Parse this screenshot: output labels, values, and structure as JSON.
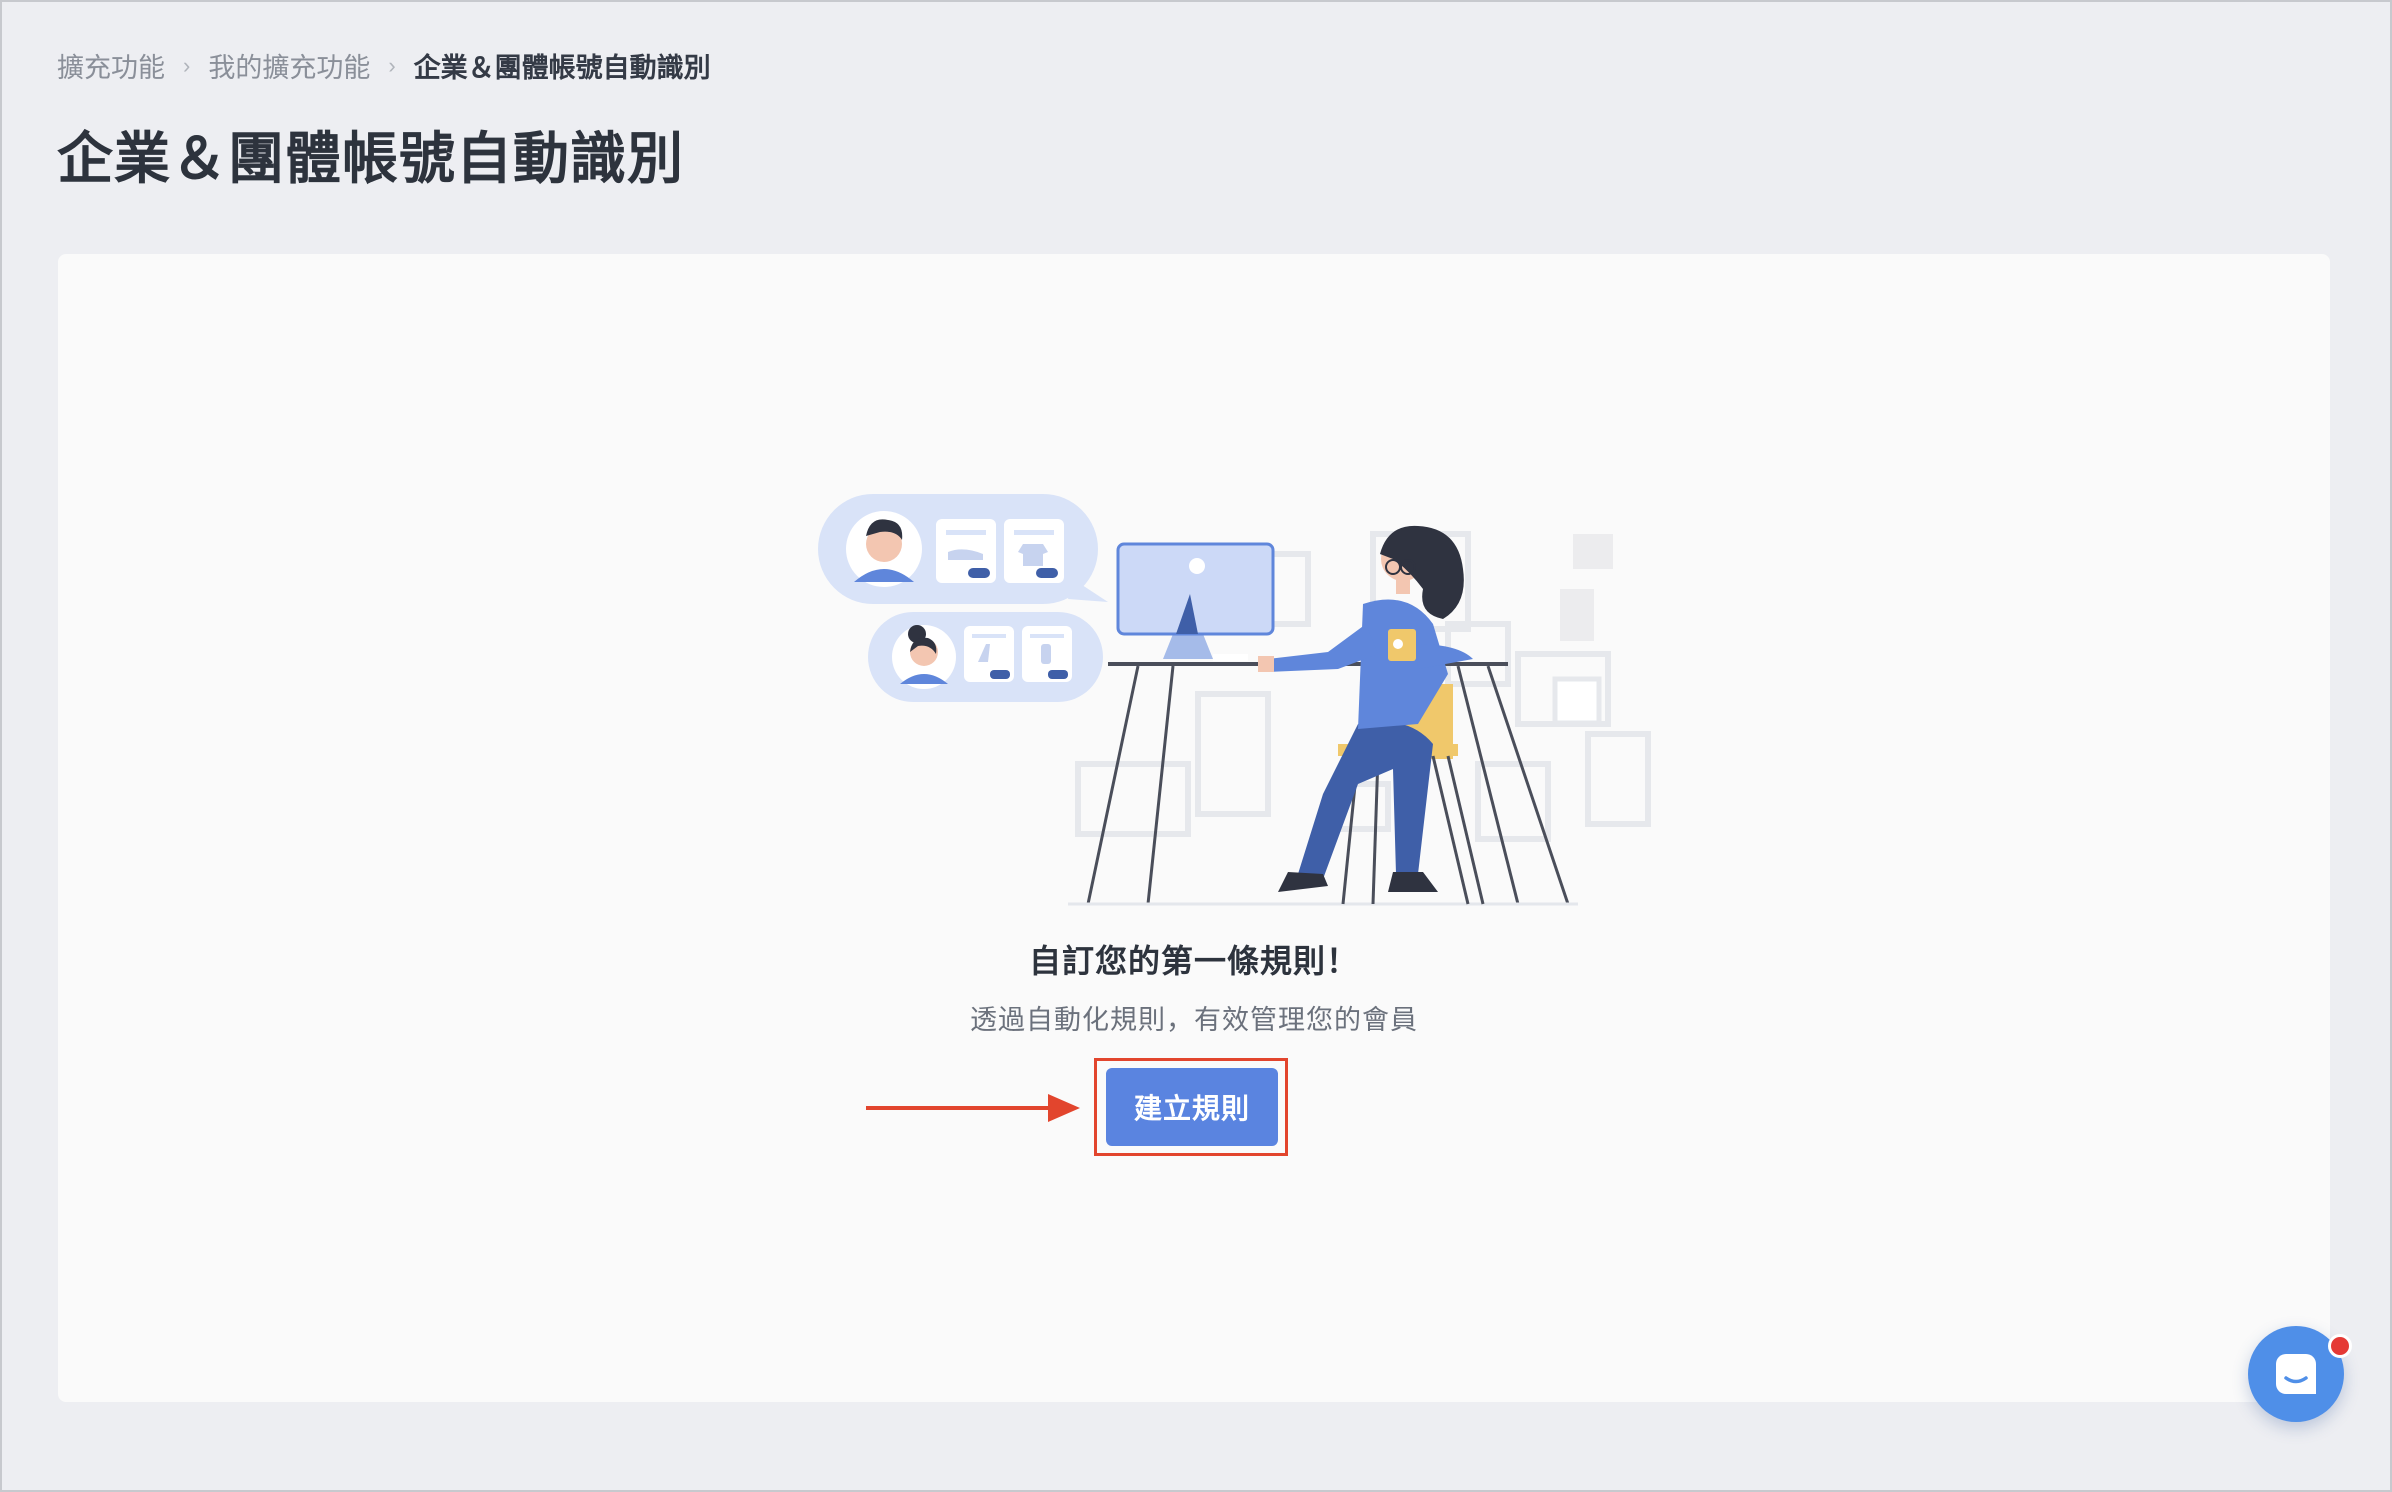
{
  "breadcrumb": {
    "items": [
      "擴充功能",
      "我的擴充功能",
      "企業＆團體帳號自動識別"
    ],
    "separator": "›"
  },
  "page": {
    "title": "企業＆團體帳號自動識別"
  },
  "empty_state": {
    "heading": "自訂您的第一條規則！",
    "description": "透過自動化規則，有效管理您的會員",
    "button_label": "建立規則"
  },
  "colors": {
    "accent": "#5a84e0",
    "highlight": "#e2452d",
    "background": "#edeef2",
    "card": "#fafafa"
  },
  "icons": {
    "illustration": "person-at-desk-illustration",
    "annotation_arrow": "arrow-right-icon",
    "chat": "chat-bubble-icon"
  }
}
